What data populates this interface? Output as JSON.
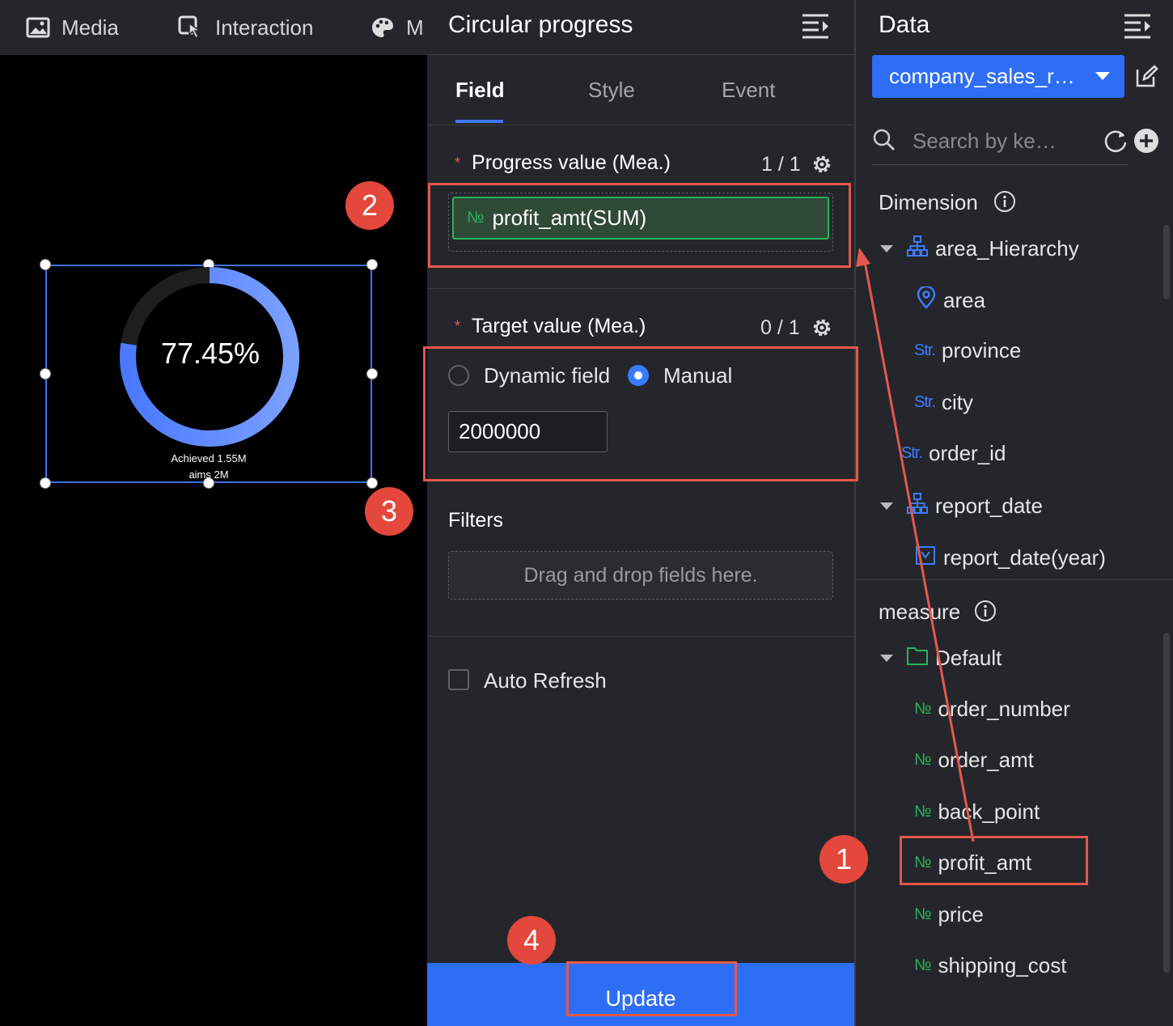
{
  "topnav": {
    "items": [
      "Media",
      "Interaction",
      "M"
    ]
  },
  "widget": {
    "percent": "77.45%",
    "progress_fraction": 0.7745,
    "caption_line1": "Achieved 1.55M",
    "caption_line2": "aims 2M"
  },
  "config": {
    "title": "Circular progress",
    "tabs": [
      "Field",
      "Style",
      "Event"
    ],
    "active_tab": "Field",
    "progress": {
      "label": "Progress value (Mea.)",
      "count": "1 / 1",
      "field": "profit_amt(SUM)",
      "field_icon": "№"
    },
    "target": {
      "label": "Target value (Mea.)",
      "count": "0 / 1",
      "option_dynamic": "Dynamic field",
      "option_manual": "Manual",
      "selected": "Manual",
      "value": "2000000"
    },
    "filters": {
      "label": "Filters",
      "placeholder": "Drag and drop fields here."
    },
    "auto_refresh": {
      "label": "Auto Refresh",
      "checked": false
    },
    "update_label": "Update"
  },
  "data_panel": {
    "title": "Data",
    "dataset": "company_sales_r…",
    "search_placeholder": "Search by ke…",
    "dimension_label": "Dimension",
    "measure_label": "measure",
    "dimensions": {
      "area_hierarchy": "area_Hierarchy",
      "area": "area",
      "province": "province",
      "city": "city",
      "order_id": "order_id",
      "report_date": "report_date",
      "report_date_year": "report_date(year)"
    },
    "measure_folder": "Default",
    "measures": [
      "order_number",
      "order_amt",
      "back_point",
      "profit_amt",
      "price",
      "shipping_cost"
    ],
    "str_icon": "Str.",
    "num_icon": "№"
  },
  "annotations": {
    "badges": [
      "1",
      "2",
      "3",
      "4"
    ],
    "color": "#e4584b"
  },
  "colors": {
    "accent": "#2e6ef5",
    "field_green": "#27b35a",
    "panel_bg": "#24262b"
  }
}
